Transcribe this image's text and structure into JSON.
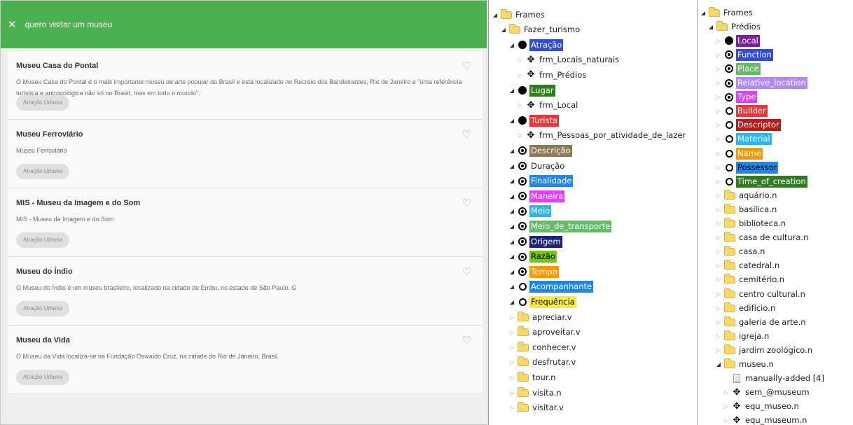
{
  "app": {
    "header": {
      "close_icon": "✕",
      "query": "quero visitar um museu",
      "color": "#4caf50"
    },
    "heart_icon": "♡",
    "results": [
      {
        "title": "Museu Casa do Pontal",
        "description": "O Museu Casa do Pontal é o mais importante museu de arte popular do Brasil e está localizado no Recreio dos Bandeirantes, Rio de Janeiro e \"uma referência turística e antropológica não só no Brasil, mas em todo o mundo\".",
        "tag": "Atração Urbana"
      },
      {
        "title": "Museu Ferroviário",
        "description": "Museu Ferroviário",
        "tag": "Atração Urbana"
      },
      {
        "title": "MIS - Museu da Imagem e do Som",
        "description": "MIS - Museu da Imagem e do Som",
        "tag": "Atração Urbana"
      },
      {
        "title": "Museu do Índio",
        "description": "O Museu do Índio é um museu brasileiro, localizado na cidade de Embu, no estado de São Paulo. G",
        "tag": "Atração Urbana"
      },
      {
        "title": "Museu da Vida",
        "description": "O Museu da Vida  localiza-se na  Fundação Oswaldo Cruz, na cidade do  Rio de Janeiro,  Brasil.",
        "tag": "Atração Urbana"
      }
    ]
  },
  "tree1": [
    {
      "label": "Frames",
      "icon": "folder",
      "exp": "open",
      "level": 0
    },
    {
      "label": "Fazer_turismo",
      "icon": "folder",
      "exp": "open",
      "level": 1
    },
    {
      "label": "Atração",
      "icon": "dot",
      "exp": "open",
      "level": 2,
      "bg": "#2f4bd8",
      "fg": "#ffffff"
    },
    {
      "label": "frm_Locais_naturais",
      "icon": "cross",
      "exp": "closed",
      "level": 3
    },
    {
      "label": "frm_Prédios",
      "icon": "cross",
      "exp": "closed",
      "level": 3
    },
    {
      "label": "Lugar",
      "icon": "dot",
      "exp": "open",
      "level": 2,
      "bg": "#2e7d1f",
      "fg": "#ffffff"
    },
    {
      "label": "frm_Local",
      "icon": "cross",
      "exp": "closed",
      "level": 3
    },
    {
      "label": "Turista",
      "icon": "dot",
      "exp": "open",
      "level": 2,
      "bg": "#e53935",
      "fg": "#ffffff"
    },
    {
      "label": "frm_Pessoas_por_atividade_de_lazer",
      "icon": "cross",
      "exp": "closed",
      "level": 3
    },
    {
      "label": "Descrição",
      "icon": "ringdot",
      "exp": "open",
      "level": 2,
      "bg": "#8d7a55",
      "fg": "#ffffff"
    },
    {
      "label": "Duração",
      "icon": "ringdot",
      "exp": "open",
      "level": 2
    },
    {
      "label": "Finalidade",
      "icon": "ringdot",
      "exp": "open",
      "level": 2,
      "bg": "#1e88e5",
      "fg": "#ffffff"
    },
    {
      "label": "Maneira",
      "icon": "ringdot",
      "exp": "open",
      "level": 2,
      "bg": "#e040fb",
      "fg": "#ffffff"
    },
    {
      "label": "Meio",
      "icon": "ringdot",
      "exp": "open",
      "level": 2,
      "bg": "#29b6f6",
      "fg": "#ffffff"
    },
    {
      "label": "Meio_de_transporte",
      "icon": "ringdot",
      "exp": "open",
      "level": 2,
      "bg": "#66bb6a",
      "fg": "#ffffff"
    },
    {
      "label": "Origem",
      "icon": "ringdot",
      "exp": "open",
      "level": 2,
      "bg": "#1a237e",
      "fg": "#ffffff"
    },
    {
      "label": "Razão",
      "icon": "ringdot",
      "exp": "open",
      "level": 2,
      "bg": "#76c21f",
      "fg": "#000000"
    },
    {
      "label": "Tempo",
      "icon": "ringdot",
      "exp": "open",
      "level": 2,
      "bg": "#ff9800",
      "fg": "#ffffff"
    },
    {
      "label": "Acompanhante",
      "icon": "ring",
      "exp": "open",
      "level": 2,
      "bg": "#1e88e5",
      "fg": "#ffffff"
    },
    {
      "label": "Frequência",
      "icon": "ring",
      "exp": "open",
      "level": 2,
      "bg": "#ffeb3b",
      "fg": "#000000"
    },
    {
      "label": "apreciar.v",
      "icon": "folder",
      "exp": "closed",
      "level": 2
    },
    {
      "label": "aproveitar.v",
      "icon": "folder",
      "exp": "closed",
      "level": 2
    },
    {
      "label": "conhecer.v",
      "icon": "folder",
      "exp": "closed",
      "level": 2
    },
    {
      "label": "desfrutar.v",
      "icon": "folder",
      "exp": "closed",
      "level": 2
    },
    {
      "label": "tour.n",
      "icon": "folder",
      "exp": "closed",
      "level": 2
    },
    {
      "label": "visita.n",
      "icon": "folder",
      "exp": "closed",
      "level": 2
    },
    {
      "label": "visitar.v",
      "icon": "folder",
      "exp": "closed",
      "level": 2
    }
  ],
  "tree2": [
    {
      "label": "Frames",
      "icon": "folder",
      "exp": "open",
      "level": 0
    },
    {
      "label": "Prédios",
      "icon": "folder",
      "exp": "open",
      "level": 1
    },
    {
      "label": "Local",
      "icon": "dot",
      "exp": "closed",
      "level": 2,
      "bg": "#7b1fa2",
      "fg": "#ffffff"
    },
    {
      "label": "Function",
      "icon": "ringdot",
      "exp": "closed",
      "level": 2,
      "bg": "#2f4bd8",
      "fg": "#ffffff"
    },
    {
      "label": "Place",
      "icon": "ringdot",
      "exp": "closed",
      "level": 2,
      "bg": "#66bb6a",
      "fg": "#ffffff"
    },
    {
      "label": "Relative_location",
      "icon": "ringdot",
      "exp": "closed",
      "level": 2,
      "bg": "#b388ff",
      "fg": "#ffffff"
    },
    {
      "label": "Type",
      "icon": "ringdot",
      "exp": "closed",
      "level": 2,
      "bg": "#e040fb",
      "fg": "#ffffff"
    },
    {
      "label": "Builder",
      "icon": "ring",
      "exp": "closed",
      "level": 2,
      "bg": "#e53935",
      "fg": "#ffffff"
    },
    {
      "label": "Descriptor",
      "icon": "ring",
      "exp": "closed",
      "level": 2,
      "bg": "#b71c1c",
      "fg": "#ffffff"
    },
    {
      "label": "Material",
      "icon": "ring",
      "exp": "closed",
      "level": 2,
      "bg": "#29b6f6",
      "fg": "#ffffff"
    },
    {
      "label": "Name",
      "icon": "ring",
      "exp": "closed",
      "level": 2,
      "bg": "#ff9800",
      "fg": "#ffffff"
    },
    {
      "label": "Possessor",
      "icon": "ring",
      "exp": "closed",
      "level": 2,
      "bg": "#1e88e5",
      "fg": "#000000"
    },
    {
      "label": "Time_of_creation",
      "icon": "ring",
      "exp": "closed",
      "level": 2,
      "bg": "#2e7d1f",
      "fg": "#ffffff"
    },
    {
      "label": "aquário.n",
      "icon": "folder",
      "exp": "closed",
      "level": 2
    },
    {
      "label": "basílica.n",
      "icon": "folder",
      "exp": "closed",
      "level": 2
    },
    {
      "label": "biblioteca.n",
      "icon": "folder",
      "exp": "closed",
      "level": 2
    },
    {
      "label": "casa de cultura.n",
      "icon": "folder",
      "exp": "closed",
      "level": 2
    },
    {
      "label": "casa.n",
      "icon": "folder",
      "exp": "closed",
      "level": 2
    },
    {
      "label": "catedral.n",
      "icon": "folder",
      "exp": "closed",
      "level": 2
    },
    {
      "label": "cemitério.n",
      "icon": "folder",
      "exp": "closed",
      "level": 2
    },
    {
      "label": "centro cultural.n",
      "icon": "folder",
      "exp": "closed",
      "level": 2
    },
    {
      "label": "edifício.n",
      "icon": "folder",
      "exp": "closed",
      "level": 2
    },
    {
      "label": "galeria de arte.n",
      "icon": "folder",
      "exp": "closed",
      "level": 2
    },
    {
      "label": "igreja.n",
      "icon": "folder",
      "exp": "closed",
      "level": 2
    },
    {
      "label": "jardim zoológico.n",
      "icon": "folder",
      "exp": "closed",
      "level": 2
    },
    {
      "label": "museu.n",
      "icon": "folder",
      "exp": "open",
      "level": 2
    },
    {
      "label": "manually-added [4]",
      "icon": "doc",
      "exp": "none",
      "level": 3
    },
    {
      "label": "sem_@museum",
      "icon": "cross",
      "exp": "closed",
      "level": 3
    },
    {
      "label": "equ_museo.n",
      "icon": "cross",
      "exp": "closed",
      "level": 3
    },
    {
      "label": "equ_museum.n",
      "icon": "cross",
      "exp": "closed",
      "level": 3
    }
  ]
}
